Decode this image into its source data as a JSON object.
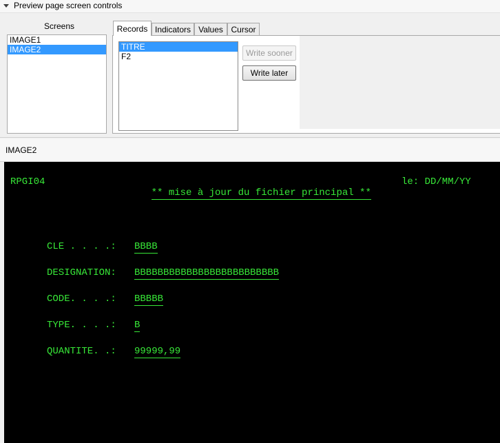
{
  "header": {
    "title": "Preview page screen controls"
  },
  "screens": {
    "label": "Screens",
    "items": [
      {
        "label": "IMAGE1",
        "selected": false
      },
      {
        "label": "IMAGE2",
        "selected": true
      }
    ]
  },
  "tabs": [
    {
      "label": "Records",
      "active": true
    },
    {
      "label": "Indicators",
      "active": false
    },
    {
      "label": "Values",
      "active": false
    },
    {
      "label": "Cursor",
      "active": false
    }
  ],
  "records": {
    "items": [
      {
        "label": "TITRE",
        "selected": true
      },
      {
        "label": "F2",
        "selected": false
      }
    ],
    "write_sooner_label": "Write sooner",
    "write_later_label": "Write later"
  },
  "preview": {
    "screen_name": "IMAGE2",
    "program": "RPGI04",
    "title": "** mise à jour du fichier principal **",
    "date": "le: DD/MM/YY",
    "fields": [
      {
        "label": "CLE . . . .:",
        "value": "BBBB"
      },
      {
        "label": "DESIGNATION:",
        "value": "BBBBBBBBBBBBBBBBBBBBBBBBB"
      },
      {
        "label": "CODE. . . .:",
        "value": "BBBBB"
      },
      {
        "label": "TYPE. . . .:",
        "value": "B"
      },
      {
        "label": "QUANTITE. .:",
        "value": "99999,99"
      }
    ]
  },
  "colors": {
    "terminal_bg": "#000000",
    "terminal_text": "#38e838",
    "selection": "#3399ff"
  }
}
